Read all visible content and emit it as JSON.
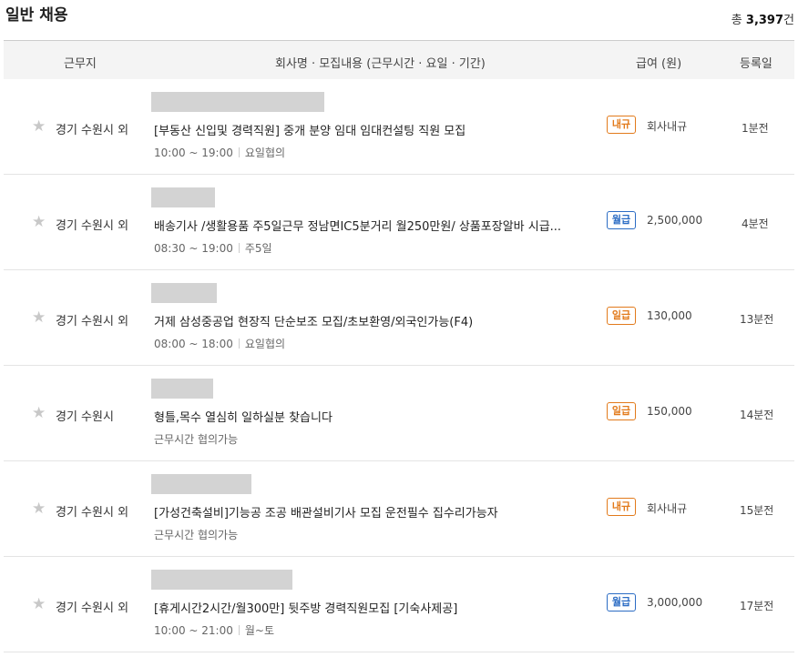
{
  "section": {
    "title": "일반 채용",
    "total_prefix": "총",
    "total_count": "3,397",
    "total_suffix": "건"
  },
  "columns": {
    "location": "근무지",
    "company": "회사명 · 모집내용 (근무시간 · 요일 · 기간)",
    "pay": "급여 (원)",
    "date": "등록일"
  },
  "colors": {
    "badge_blue": "#2b6cc4",
    "badge_orange": "#e27a1b"
  },
  "rows": [
    {
      "location": "경기 수원시 외",
      "title": "[부동산 신입및 경력직원] 중개 분양 임대 임대컨설팅 직원 모집",
      "time": "10:00 ~ 19:00",
      "days": "요일협의",
      "badge": "내규",
      "pay": "회사내규",
      "date": "1분전"
    },
    {
      "location": "경기 수원시 외",
      "title": "배송기사 /생활용품 주5일근무 정남면IC5분거리 월250만원/ 상품포장알바 시급...",
      "time": "08:30 ~ 19:00",
      "days": "주5일",
      "badge": "월급",
      "pay": "2,500,000",
      "date": "4분전"
    },
    {
      "location": "경기 수원시 외",
      "title": "거제 삼성중공업 현장직 단순보조 모집/초보환영/외국인가능(F4)",
      "time": "08:00 ~ 18:00",
      "days": "요일협의",
      "badge": "일급",
      "pay": "130,000",
      "date": "13분전"
    },
    {
      "location": "경기 수원시",
      "title": "형틀,목수 열심히 일하실분 찾습니다",
      "time": "근무시간 협의가능",
      "days": "",
      "badge": "일급",
      "pay": "150,000",
      "date": "14분전"
    },
    {
      "location": "경기 수원시 외",
      "title": "[가성건축설비]기능공 조공 배관설비기사 모집 운전필수 집수리가능자",
      "time": "근무시간 협의가능",
      "days": "",
      "badge": "내규",
      "pay": "회사내규",
      "date": "15분전"
    },
    {
      "location": "경기 수원시 외",
      "title": "[휴게시간2시간/월300만] 뒷주방 경력직원모집 [기숙사제공]",
      "time": "10:00 ~ 21:00",
      "days": "월~토",
      "badge": "월급",
      "pay": "3,000,000",
      "date": "17분전"
    }
  ]
}
